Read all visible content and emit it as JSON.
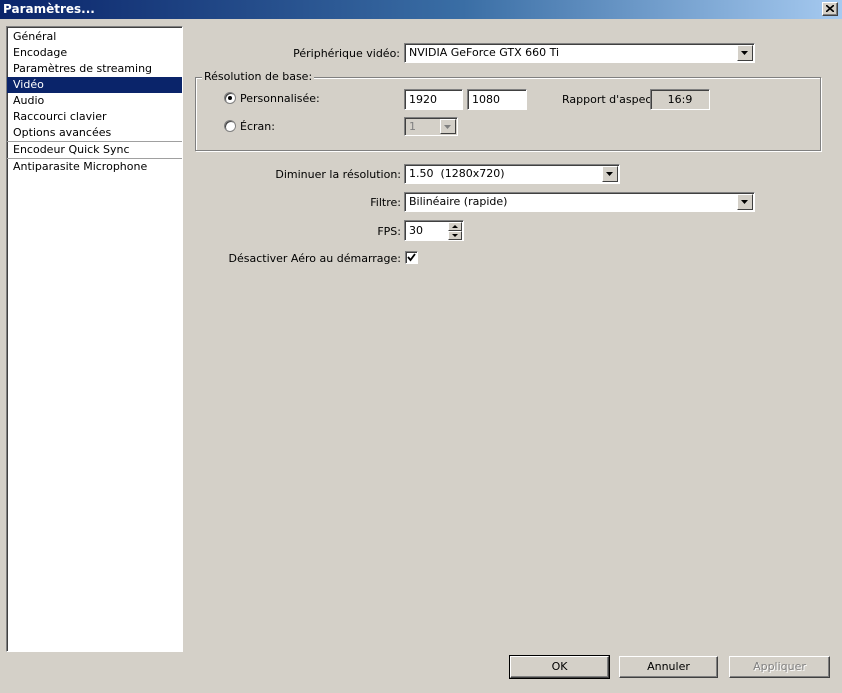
{
  "window": {
    "title": "Paramètres..."
  },
  "sidebar": {
    "items": [
      {
        "label": "Général"
      },
      {
        "label": "Encodage"
      },
      {
        "label": "Paramètres de streaming"
      },
      {
        "label": "Vidéo",
        "selected": true
      },
      {
        "label": "Audio"
      },
      {
        "label": "Raccourci clavier"
      },
      {
        "label": "Options avancées"
      },
      {
        "label": "Encodeur Quick Sync"
      },
      {
        "label": "Antiparasite Microphone"
      }
    ]
  },
  "video": {
    "device_label": "Périphérique vidéo:",
    "device_value": "NVIDIA GeForce GTX 660 Ti",
    "base_resolution": {
      "group_label": "Résolution de base:",
      "custom_label": "Personnalisée:",
      "custom_selected": true,
      "width": "1920",
      "height": "1080",
      "aspect_label": "Rapport d'aspect",
      "aspect_value": "16:9",
      "screen_label": "Écran:",
      "screen_value": "1"
    },
    "downscale_label": "Diminuer la résolution:",
    "downscale_value": "1.50  (1280x720)",
    "filter_label": "Filtre:",
    "filter_value": "Bilinéaire (rapide)",
    "fps_label": "FPS:",
    "fps_value": "30",
    "disable_aero_label": "Désactiver Aéro au démarrage:",
    "disable_aero_checked": true
  },
  "buttons": {
    "ok": "OK",
    "cancel": "Annuler",
    "apply": "Appliquer"
  }
}
